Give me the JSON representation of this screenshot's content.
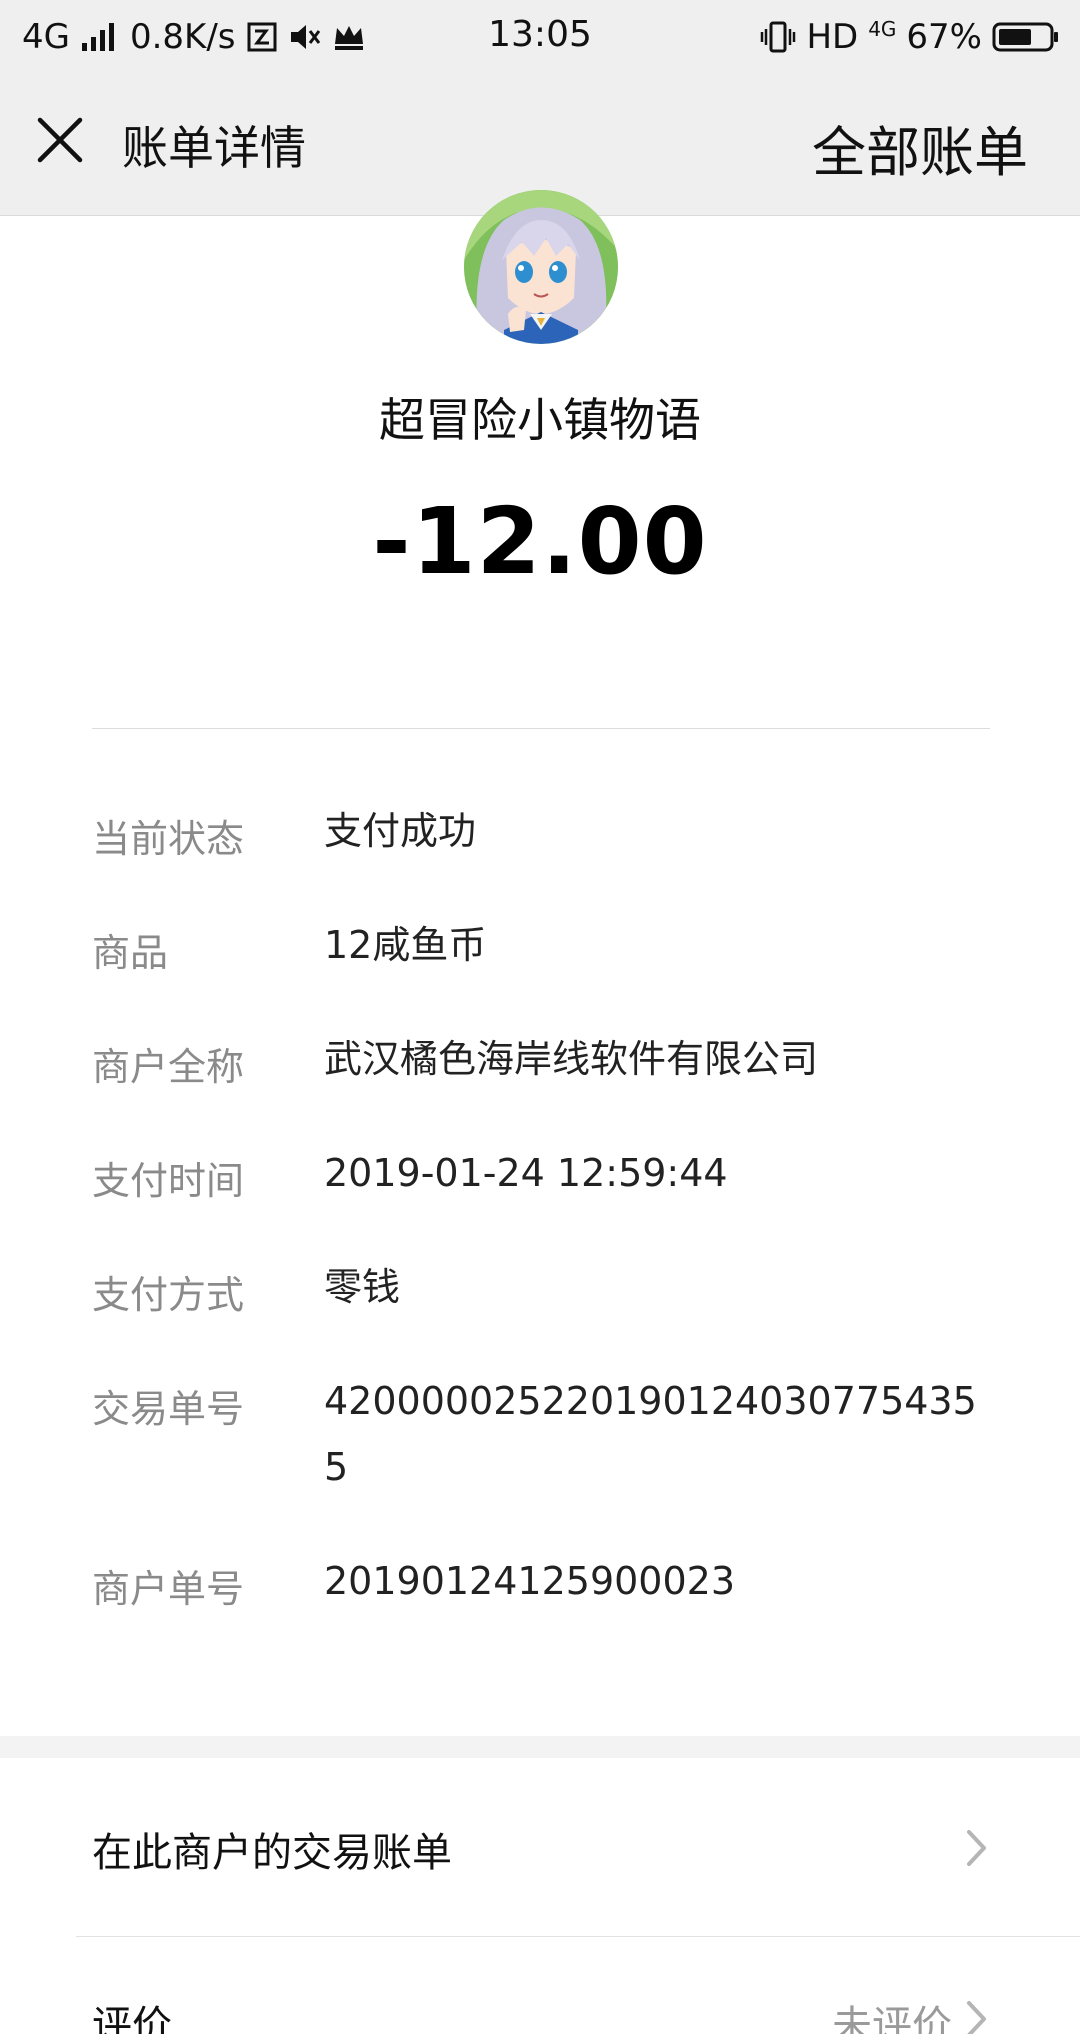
{
  "status_bar": {
    "network": "4G",
    "speed": "0.8K/s",
    "time": "13:05",
    "hd": "HD",
    "net4g_small": "4G",
    "battery_percent": "67%",
    "battery_level": 0.67
  },
  "header": {
    "title": "账单详情",
    "right_link": "全部账单"
  },
  "merchant": {
    "name": "超冒险小镇物语",
    "amount": "-12.00"
  },
  "details": [
    {
      "label": "当前状态",
      "value": "支付成功"
    },
    {
      "label": "商品",
      "value": "12咸鱼币"
    },
    {
      "label": "商户全称",
      "value": "武汉橘色海岸线软件有限公司"
    },
    {
      "label": "支付时间",
      "value": "2019-01-24 12:59:44"
    },
    {
      "label": "支付方式",
      "value": "零钱"
    },
    {
      "label": "交易单号",
      "value": "4200000252201901240307754355"
    },
    {
      "label": "商户单号",
      "value": "20190124125900023"
    }
  ],
  "actions": {
    "merchant_bills": "在此商户的交易账单",
    "review_label": "评价",
    "review_status": "未评价"
  },
  "colors": {
    "bar_bg": "#efefef",
    "label_gray": "#8a8a8a",
    "text_dark": "#111111"
  }
}
